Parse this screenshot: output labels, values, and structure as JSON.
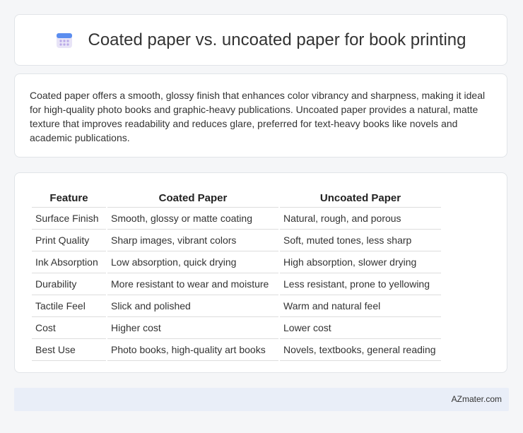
{
  "header": {
    "title": "Coated paper vs. uncoated paper for book printing",
    "icon": "calendar-icon"
  },
  "intro": {
    "text": "Coated paper offers a smooth, glossy finish that enhances color vibrancy and sharpness, making it ideal for high-quality photo books and graphic-heavy publications. Uncoated paper provides a natural, matte texture that improves readability and reduces glare, preferred for text-heavy books like novels and academic publications."
  },
  "table": {
    "headers": [
      "Feature",
      "Coated Paper",
      "Uncoated Paper"
    ],
    "rows": [
      [
        "Surface Finish",
        "Smooth, glossy or matte coating",
        "Natural, rough, and porous"
      ],
      [
        "Print Quality",
        "Sharp images, vibrant colors",
        "Soft, muted tones, less sharp"
      ],
      [
        "Ink Absorption",
        "Low absorption, quick drying",
        "High absorption, slower drying"
      ],
      [
        "Durability",
        "More resistant to wear and moisture",
        "Less resistant, prone to yellowing"
      ],
      [
        "Tactile Feel",
        "Slick and polished",
        "Warm and natural feel"
      ],
      [
        "Cost",
        "Higher cost",
        "Lower cost"
      ],
      [
        "Best Use",
        "Photo books, high-quality art books",
        "Novels, textbooks, general reading"
      ]
    ]
  },
  "footer": {
    "brand": "AZmater.com"
  }
}
